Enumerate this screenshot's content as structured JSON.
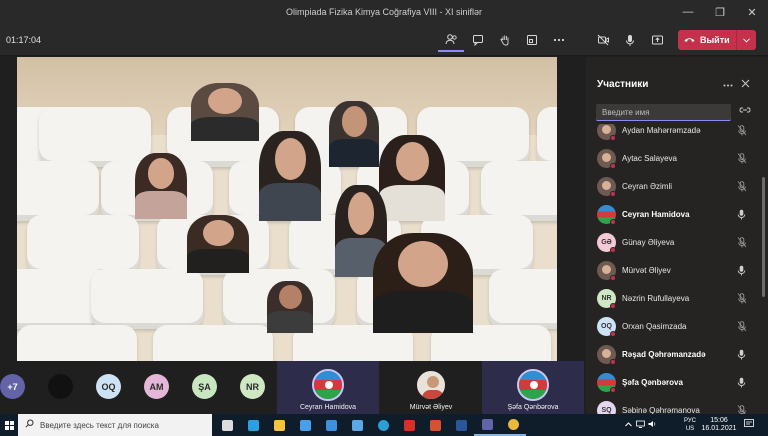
{
  "window": {
    "title": "Olimpiada Fizika Kimya Coğrafiya VIII - XI siniflər",
    "controls": [
      "—",
      "❐",
      "✕"
    ]
  },
  "toolbar": {
    "timer": "01:17:04",
    "icons": [
      "people-icon",
      "chat-icon",
      "raise-hand-icon",
      "breakout-icon",
      "more-icon",
      "camera-off-icon",
      "mic-icon",
      "share-icon"
    ],
    "leave_label": "Выйти"
  },
  "participants_panel": {
    "title": "Участники",
    "search_placeholder": "Введите имя",
    "people": [
      {
        "name": "Aydan Mahərrəmzadə",
        "avatar": "photo",
        "mic": "muted",
        "bold": false
      },
      {
        "name": "Aytac Salayeva",
        "avatar": "photo",
        "mic": "muted",
        "bold": false
      },
      {
        "name": "Ceyran Əzimli",
        "avatar": "photo",
        "mic": "muted",
        "bold": false
      },
      {
        "name": "Ceyran Hamidova",
        "avatar": "flag",
        "mic": "on",
        "bold": true
      },
      {
        "name": "Günay Əliyeva",
        "avatar": "GƏ",
        "avatar_color": "#f3c9d7",
        "mic": "muted",
        "bold": false
      },
      {
        "name": "Mürvət Əliyev",
        "avatar": "photo",
        "mic": "on",
        "bold": false
      },
      {
        "name": "Nəzrin Rufullayeva",
        "avatar": "NR",
        "avatar_color": "#cfe8c4",
        "mic": "muted",
        "bold": false
      },
      {
        "name": "Orxan Qasimzada",
        "avatar": "OQ",
        "avatar_color": "#cde3f5",
        "mic": "muted",
        "bold": false
      },
      {
        "name": "Rəşad Qəhrəmanzadə",
        "avatar": "photo",
        "mic": "on",
        "bold": true
      },
      {
        "name": "Şəfa Qənbərova",
        "avatar": "flag",
        "mic": "on",
        "bold": true
      },
      {
        "name": "Səbinə Qəhrəmanova",
        "avatar": "SQ",
        "avatar_color": "#e4d6f0",
        "mic": "muted",
        "bold": false
      }
    ]
  },
  "gallery": {
    "avatars": [
      {
        "label": "+7",
        "color": "#6264a7",
        "text_color": "#ffffff"
      },
      {
        "label": "",
        "color": "#111111",
        "text_color": "#ffffff"
      },
      {
        "label": "OQ",
        "color": "#cde3f5",
        "text_color": "#2a2a2a"
      },
      {
        "label": "AM",
        "color": "#e4b6d9",
        "text_color": "#2a2a2a"
      },
      {
        "label": "ŞA",
        "color": "#c8e6c0",
        "text_color": "#2a2a2a"
      },
      {
        "label": "NR",
        "color": "#cfe8c4",
        "text_color": "#2a2a2a"
      }
    ],
    "tiles": [
      {
        "name": "Ceyran Hamidova",
        "type": "flag"
      },
      {
        "name": "Mürvət Əliyev",
        "type": "photo"
      },
      {
        "name": "Şəfa Qənbərova",
        "type": "flag"
      }
    ]
  },
  "taskbar": {
    "search_placeholder": "Введите здесь текст для поиска",
    "apps": [
      {
        "name": "task-view",
        "color": "#dcdcdc"
      },
      {
        "name": "edge",
        "color": "#2aa0e0"
      },
      {
        "name": "explorer",
        "color": "#f5c242"
      },
      {
        "name": "store",
        "color": "#4aa0e8"
      },
      {
        "name": "mail",
        "color": "#3f8fdf"
      },
      {
        "name": "photos",
        "color": "#5aa9e6"
      },
      {
        "name": "skype",
        "color": "#2a9fd6"
      },
      {
        "name": "acrobat",
        "color": "#d93025"
      },
      {
        "name": "powerpoint",
        "color": "#d35230"
      },
      {
        "name": "word",
        "color": "#2b579a"
      },
      {
        "name": "teams",
        "color": "#6264a7"
      },
      {
        "name": "chrome",
        "color": "#e8b93a"
      }
    ],
    "lang_top": "РУС",
    "lang_bottom": "US",
    "time": "15:06",
    "date": "16.01.2021"
  }
}
